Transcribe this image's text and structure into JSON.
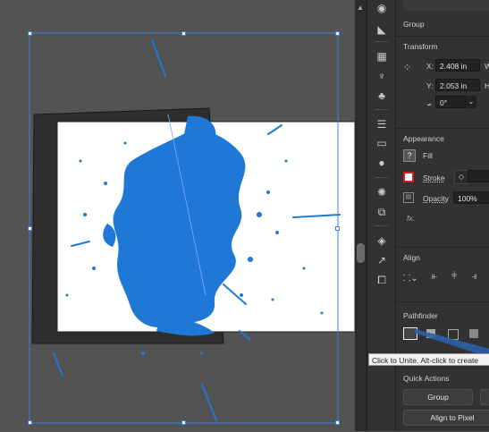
{
  "properties": {
    "group_label": "Group",
    "transform": {
      "title": "Transform",
      "x_label": "X:",
      "x_value": "2.408 in",
      "y_label": "Y:",
      "y_value": "2.053 in",
      "w_label": "W",
      "h_label": "H",
      "angle_value": "0°"
    },
    "appearance": {
      "title": "Appearance",
      "fill_label": "Fill",
      "fill_swatch": "?",
      "stroke_label": "Stroke",
      "opacity_label": "Opacity",
      "opacity_value": "100%",
      "fx_label": "fx."
    },
    "align": {
      "title": "Align"
    },
    "pathfinder": {
      "title": "Pathfinder"
    },
    "quick_actions": {
      "title": "Quick Actions",
      "group_button": "Group",
      "align_pixel_button": "Align to Pixel"
    }
  },
  "tooltip": {
    "text": "Click to Unite. Alt-click to create"
  },
  "colors": {
    "accent": "#1f78d6",
    "selection": "#3d7dde",
    "canvas": "#535353",
    "panel": "#323232",
    "stroke_red": "#d02020"
  }
}
